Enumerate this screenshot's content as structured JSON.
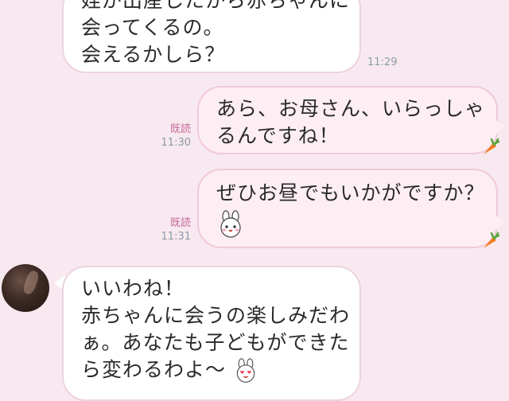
{
  "messages": [
    {
      "id": "m1",
      "direction": "incoming",
      "lines": [
        "姪が出産したから赤ちゃんに",
        "会ってくるの。",
        "会えるかしら？"
      ],
      "time": "11:29"
    },
    {
      "id": "m2",
      "direction": "outgoing",
      "lines": [
        "あら、お母さん、いらっしゃ",
        "るんですね！"
      ],
      "read_label": "既読",
      "time": "11:30",
      "decoration": "carrot-icon"
    },
    {
      "id": "m3",
      "direction": "outgoing",
      "lines": [
        "ぜひお昼でもいかがですか？"
      ],
      "sticker": "cony-bunny-icon",
      "read_label": "既読",
      "time": "11:31",
      "decoration": "carrot-icon"
    },
    {
      "id": "m4",
      "direction": "incoming",
      "lines": [
        "いいわね！",
        "赤ちゃんに会うの楽しみだわ",
        "ぁ。あなたも子どもができた",
        "ら変わるわよ〜"
      ],
      "sticker": "cony-heart-eyes-icon"
    }
  ],
  "colors": {
    "background": "#f8e9f0",
    "incoming_bubble": "#ffffff",
    "outgoing_bubble": "#fdeef4",
    "read_label": "#c46a9a",
    "timestamp": "#8b9aa7"
  }
}
